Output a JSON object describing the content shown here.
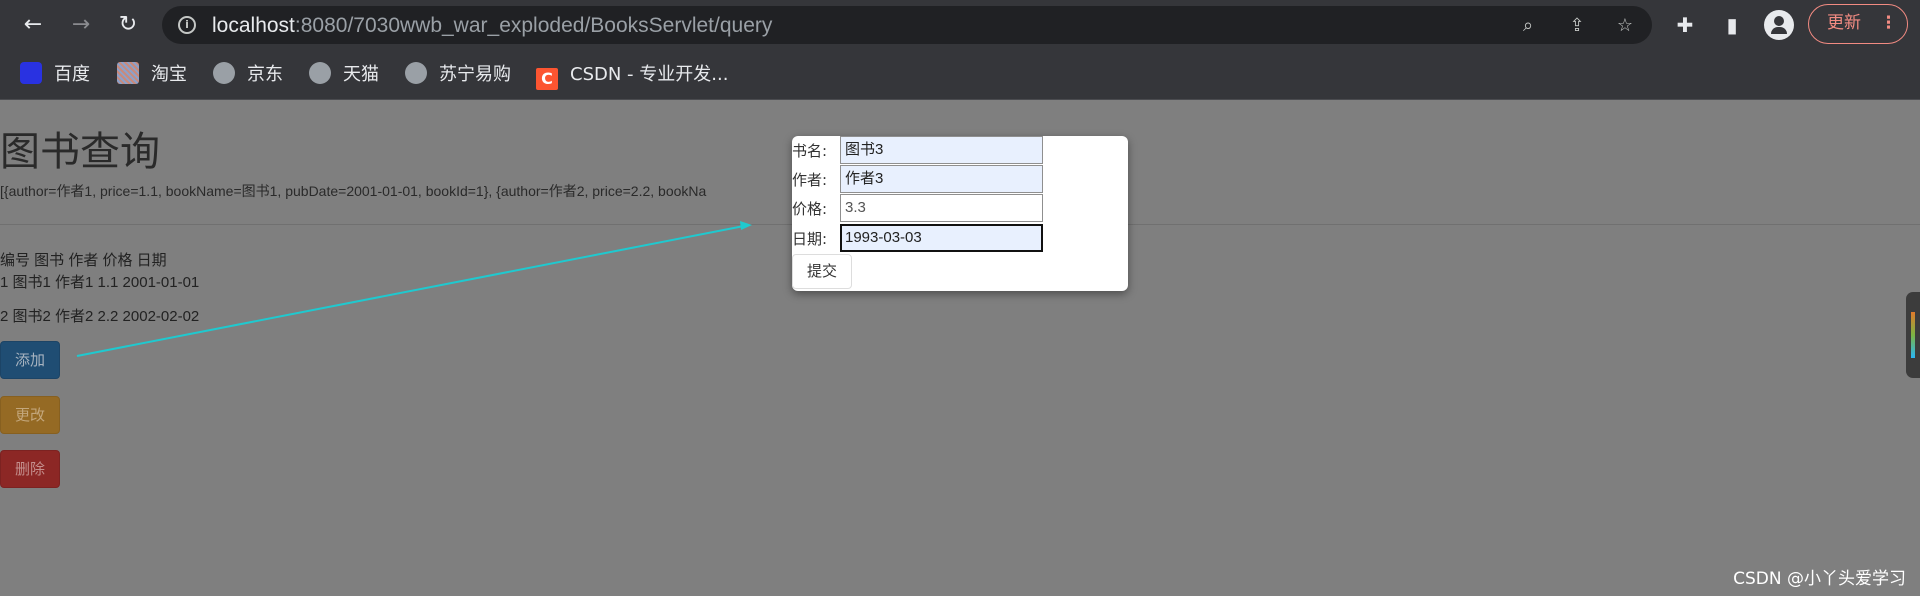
{
  "browser": {
    "url_host": "localhost",
    "url_rest": ":8080/7030wwb_war_exploded/BooksServlet/query",
    "update_label": "更新",
    "colors": {
      "chrome": "#35363a",
      "omnibox": "#202124",
      "update": "#f28b82"
    },
    "icons": [
      "back-icon",
      "forward-icon",
      "reload-icon",
      "info-icon",
      "zoom-icon",
      "share-icon",
      "star-icon",
      "extensions-icon",
      "sidepanel-icon",
      "profile-icon",
      "more-icon"
    ]
  },
  "bookmarks": [
    {
      "label": "百度",
      "icon": "baidu-icon"
    },
    {
      "label": "淘宝",
      "icon": "taobao-icon"
    },
    {
      "label": "京东",
      "icon": "globe-icon"
    },
    {
      "label": "天猫",
      "icon": "globe-icon"
    },
    {
      "label": "苏宁易购",
      "icon": "globe-icon"
    },
    {
      "label": "CSDN - 专业开发...",
      "icon": "csdn-icon"
    }
  ],
  "page": {
    "title": "图书查询",
    "list_string": "[{author=作者1, price=1.1, bookName=图书1, pubDate=2001-01-01, bookId=1}, {author=作者2, price=2.2, bookNa",
    "table_header": "编号 图书 作者 价格 日期",
    "rows": [
      "1 图书1 作者1 1.1 2001-01-01",
      "2 图书2 作者2 2.2 2002-02-02"
    ],
    "buttons": {
      "add": "添加",
      "edit": "更改",
      "delete": "删除"
    },
    "colors": {
      "add": "#1f4d73",
      "edit": "#956a24",
      "delete": "#8c2725",
      "arrow": "#1fc9cf"
    }
  },
  "form": {
    "fields": [
      {
        "label": "书名:",
        "value": "图书3"
      },
      {
        "label": "作者:",
        "value": "作者3"
      },
      {
        "label": "价格:",
        "value": "3.3"
      },
      {
        "label": "日期:",
        "value": "1993-03-03"
      }
    ],
    "submit_label": "提交"
  },
  "watermark": "CSDN @小丫头爱学习"
}
